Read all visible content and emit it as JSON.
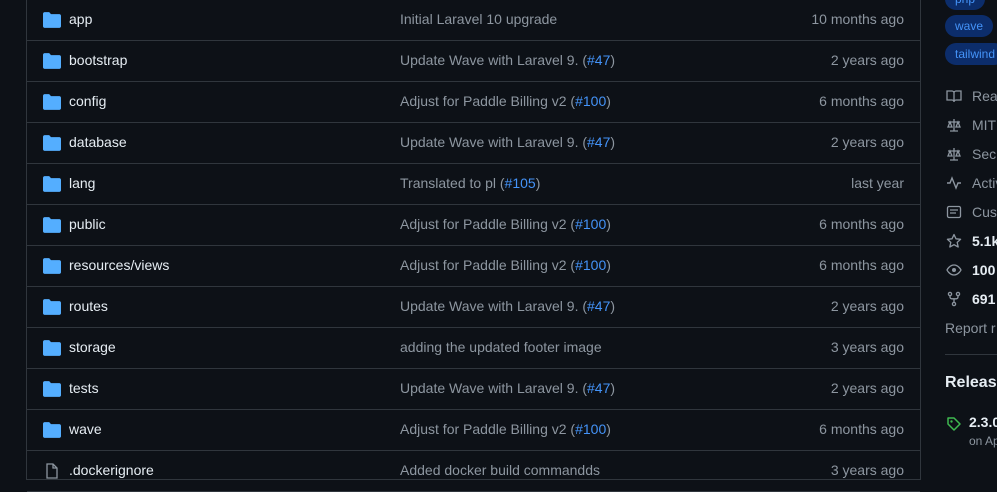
{
  "files": [
    {
      "name": "app",
      "icon": "folder-icon",
      "message": "Initial Laravel 10 upgrade",
      "pr": "",
      "suffix": "",
      "age": "10 months ago"
    },
    {
      "name": "bootstrap",
      "icon": "folder-icon",
      "message": "Update Wave with Laravel 9. (",
      "pr": "#47",
      "suffix": ")",
      "age": "2 years ago"
    },
    {
      "name": "config",
      "icon": "folder-icon",
      "message": "Adjust for Paddle Billing v2 (",
      "pr": "#100",
      "suffix": ")",
      "age": "6 months ago"
    },
    {
      "name": "database",
      "icon": "folder-icon",
      "message": "Update Wave with Laravel 9. (",
      "pr": "#47",
      "suffix": ")",
      "age": "2 years ago"
    },
    {
      "name": "lang",
      "icon": "folder-icon",
      "message": "Translated to pl (",
      "pr": "#105",
      "suffix": ")",
      "age": "last year"
    },
    {
      "name": "public",
      "icon": "folder-icon",
      "message": "Adjust for Paddle Billing v2 (",
      "pr": "#100",
      "suffix": ")",
      "age": "6 months ago"
    },
    {
      "name": "resources/views",
      "icon": "folder-icon",
      "message": "Adjust for Paddle Billing v2 (",
      "pr": "#100",
      "suffix": ")",
      "age": "6 months ago"
    },
    {
      "name": "routes",
      "icon": "folder-icon",
      "message": "Update Wave with Laravel 9. (",
      "pr": "#47",
      "suffix": ")",
      "age": "2 years ago"
    },
    {
      "name": "storage",
      "icon": "folder-icon",
      "message": "adding the updated footer image",
      "pr": "",
      "suffix": "",
      "age": "3 years ago"
    },
    {
      "name": "tests",
      "icon": "folder-icon",
      "message": "Update Wave with Laravel 9. (",
      "pr": "#47",
      "suffix": ")",
      "age": "2 years ago"
    },
    {
      "name": "wave",
      "icon": "folder-icon",
      "message": "Adjust for Paddle Billing v2 (",
      "pr": "#100",
      "suffix": ")",
      "age": "6 months ago"
    },
    {
      "name": ".dockerignore",
      "icon": "file-icon",
      "message": "Added docker build commandds",
      "pr": "",
      "suffix": "",
      "age": "3 years ago"
    }
  ],
  "sidebar": {
    "topics": [
      "php",
      "wave",
      "tailwind"
    ],
    "about": [
      {
        "icon": "book-icon",
        "label": "Rea",
        "strong": false
      },
      {
        "icon": "law-icon",
        "label": "MIT",
        "strong": false
      },
      {
        "icon": "law-icon",
        "label": "Sec",
        "strong": false
      },
      {
        "icon": "pulse-icon",
        "label": "Activ",
        "strong": false
      },
      {
        "icon": "comment-icon",
        "label": "Cus",
        "strong": false
      },
      {
        "icon": "star-icon",
        "label": "5.1k",
        "strong": true
      },
      {
        "icon": "eye-icon",
        "label": "100",
        "strong": true
      },
      {
        "icon": "fork-icon",
        "label": "691",
        "strong": true
      }
    ],
    "report": "Report r",
    "releases_heading": "Releas",
    "release_version": "2.3.0",
    "release_date": "on Ap"
  },
  "colors": {
    "background": "#0d1117",
    "border": "#30363d",
    "folder": "#54aeff",
    "link": "#4493f8",
    "muted": "#8d96a0",
    "topic_bg": "#0c2d6b"
  }
}
